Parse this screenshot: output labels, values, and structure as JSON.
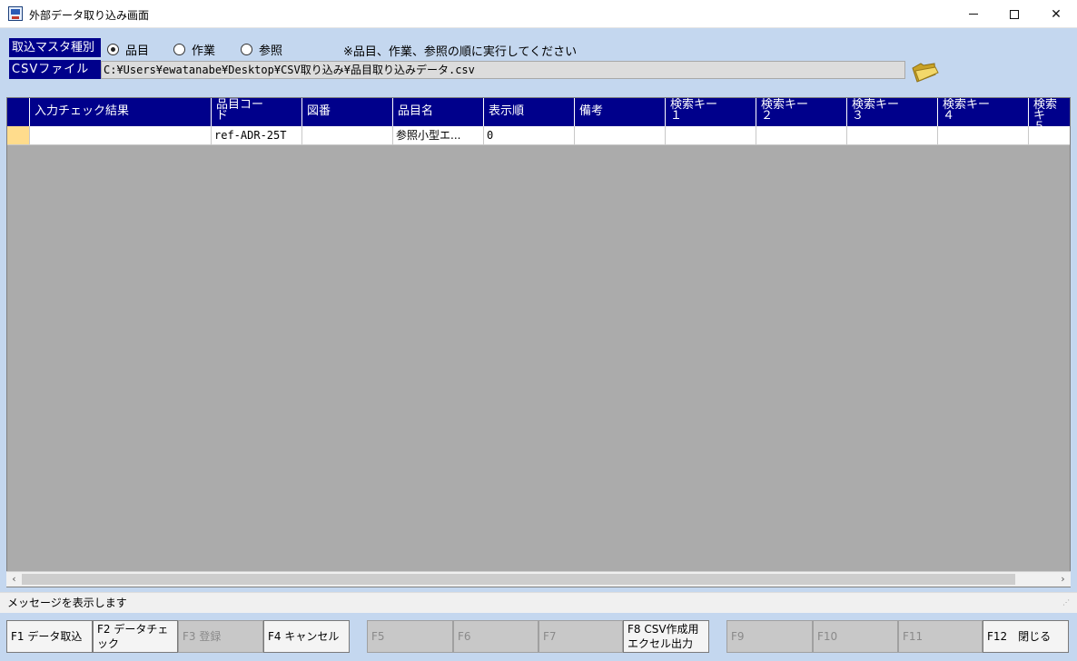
{
  "window": {
    "title": "外部データ取り込み画面"
  },
  "form": {
    "master_label": "取込マスタ種別",
    "radios": [
      {
        "label": "品目",
        "selected": true
      },
      {
        "label": "作業",
        "selected": false
      },
      {
        "label": "参照",
        "selected": false
      }
    ],
    "note": "※品目、作業、参照の順に実行してください",
    "csv_label": "CSVファイル",
    "csv_path": "C:¥Users¥ewatanabe¥Desktop¥CSV取り込み¥品目取り込みデータ.csv"
  },
  "grid": {
    "headers": [
      "入力チェック結果",
      "品目コー\nド",
      "図番",
      "品目名",
      "表示順",
      "備考",
      "検索キー\n１",
      "検索キー\n２",
      "検索キー\n３",
      "検索キー\n４",
      "検索キ\n５"
    ],
    "rows": [
      [
        "",
        "ref-ADR-25T",
        "",
        "参照小型エ...",
        "0",
        "",
        "",
        "",
        "",
        "",
        ""
      ]
    ]
  },
  "status": {
    "message": "メッセージを表示します"
  },
  "function_keys": [
    {
      "label": "F1 データ取込",
      "enabled": true
    },
    {
      "label": "F2 データチェ\nック",
      "enabled": true
    },
    {
      "label": "F3 登録",
      "enabled": false
    },
    {
      "label": "F4 キャンセル",
      "enabled": true
    },
    {
      "label": "F5",
      "enabled": false
    },
    {
      "label": "F6",
      "enabled": false
    },
    {
      "label": "F7",
      "enabled": false
    },
    {
      "label": "F8 CSV作成用\nエクセル出力",
      "enabled": true
    },
    {
      "label": "F9",
      "enabled": false
    },
    {
      "label": "F10",
      "enabled": false
    },
    {
      "label": "F11",
      "enabled": false
    },
    {
      "label": "F12　閉じる",
      "enabled": true
    }
  ]
}
